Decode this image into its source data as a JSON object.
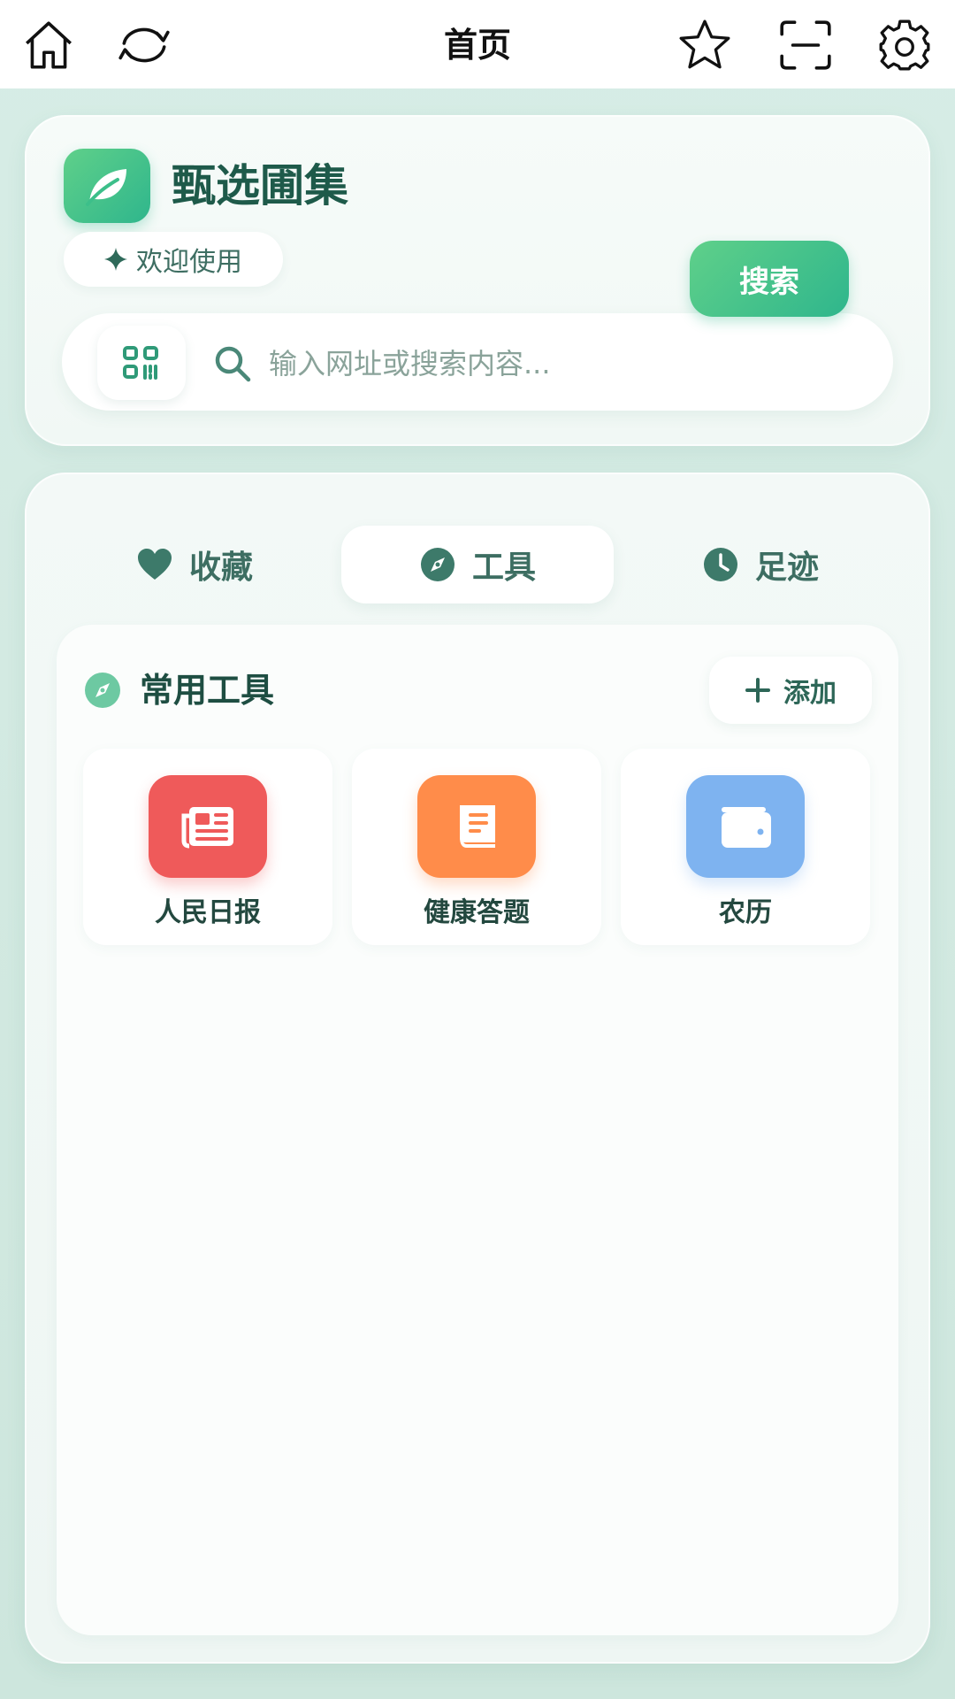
{
  "topbar": {
    "title": "首页",
    "icons": [
      "home-icon",
      "refresh-icon",
      "star-icon",
      "scan-icon",
      "gear-icon"
    ]
  },
  "brand": {
    "name": "甄选圃集",
    "welcome": "欢迎使用",
    "accent_color": "#2fb68c",
    "accent_color_light": "#5fd08a"
  },
  "search": {
    "placeholder": "输入网址或搜索内容...",
    "value": "",
    "button_label": "搜索"
  },
  "tabs": [
    {
      "label": "收藏",
      "icon": "heart-icon",
      "active": false
    },
    {
      "label": "工具",
      "icon": "compass-icon",
      "active": true
    },
    {
      "label": "足迹",
      "icon": "clock-icon",
      "active": false
    }
  ],
  "tools": {
    "section_title": "常用工具",
    "add_label": "添加",
    "items": [
      {
        "label": "人民日报",
        "icon": "newspaper-icon",
        "color": "#ef5a5a"
      },
      {
        "label": "健康答题",
        "icon": "book-icon",
        "color": "#ff8c4a"
      },
      {
        "label": "农历",
        "icon": "wallet-icon",
        "color": "#7eb3f0"
      }
    ]
  }
}
